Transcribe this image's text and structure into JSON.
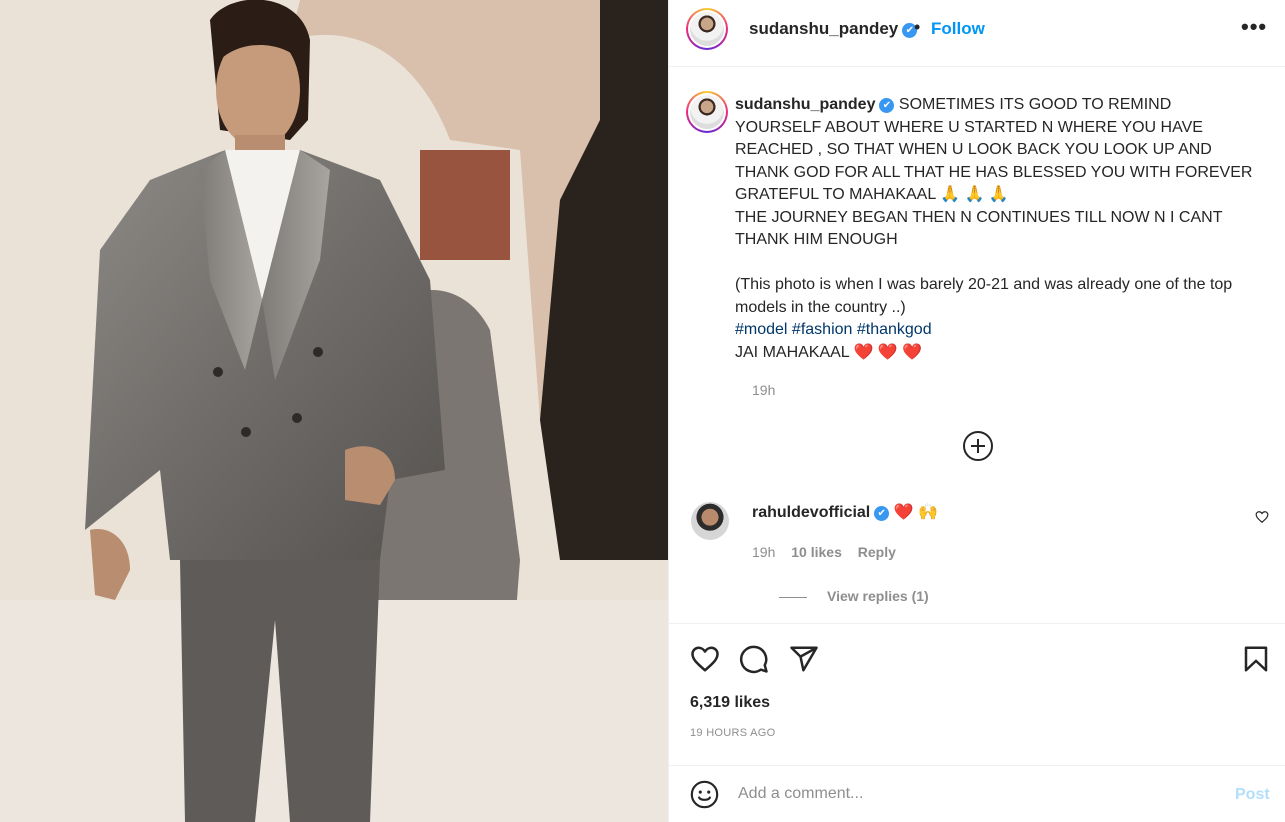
{
  "post": {
    "username": "sudanshu_pandey",
    "verified_mark": "✔",
    "separator": "•",
    "follow_label": "Follow",
    "more_label": "•••"
  },
  "caption": {
    "username": "sudanshu_pandey",
    "text": " SOMETIMES ITS GOOD TO REMIND YOURSELF ABOUT WHERE U STARTED N WHERE YOU HAVE REACHED , SO THAT WHEN U LOOK BACK YOU LOOK UP AND THANK GOD FOR ALL THAT HE HAS BLESSED YOU WITH FOREVER GRATEFUL TO MAHAKAAL 🙏 🙏 🙏\nTHE JOURNEY BEGAN THEN N CONTINUES TILL NOW N I CANT THANK HIM ENOUGH\n\n(This photo is when I was barely 20-21 and was already one of the top models in the country ..)\n",
    "hashtags": "#model #fashion #thankgod",
    "closing": "\nJAI MAHAKAAL ❤️ ❤️ ❤️",
    "time": "19h"
  },
  "comment": {
    "username": "rahuldevofficial",
    "text": " ❤️ 🙌",
    "time": "19h",
    "likes": "10 likes",
    "reply_label": "Reply",
    "view_replies": "View replies (1)"
  },
  "stats": {
    "likes": "6,319 likes",
    "time_ago": "19 HOURS AGO"
  },
  "add_comment": {
    "placeholder": "Add a comment...",
    "post_label": "Post"
  },
  "icons": [
    "heart-icon",
    "comment-icon",
    "share-icon",
    "bookmark-icon",
    "emoji-icon",
    "add-circle-icon",
    "more-icon"
  ],
  "colors": {
    "link_blue": "#0095f6",
    "hashtag_blue": "#00376b",
    "muted": "#8e8e8e",
    "post_disabled": "#b2dffc",
    "heart_red": "#ed4956"
  }
}
